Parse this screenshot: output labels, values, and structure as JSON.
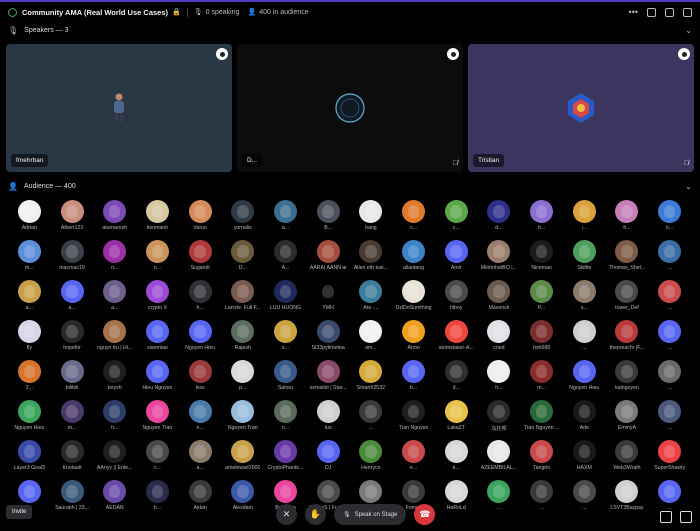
{
  "topbar": {
    "title": "Community AMA (Real World Use Cases)",
    "speaking": "0 speaking",
    "audience_count": "400 in audience"
  },
  "speakers_section": {
    "label": "Speakers — 3"
  },
  "speakers": [
    {
      "name": "fmehrban",
      "bg": "#2a3846",
      "figure": "person"
    },
    {
      "name": "D...",
      "bg": "#0c0c0d",
      "figure": "orb"
    },
    {
      "name": "Tristian",
      "bg": "#3b3560",
      "figure": "lion"
    }
  ],
  "audience_section": {
    "label": "Audience — 400"
  },
  "audience": [
    {
      "name": "Adrian",
      "color": "#f0f0f0"
    },
    {
      "name": "Albert123",
      "color": "#c98d7e"
    },
    {
      "name": "aturnaresh",
      "color": "#7b4bb3"
    },
    {
      "name": "tienmanh",
      "color": "#d6c7a1"
    },
    {
      "name": "Varun",
      "color": "#d68a5b"
    },
    {
      "name": "yurnalis",
      "color": "#2f3a45"
    },
    {
      "name": "a...",
      "color": "#3c6e8f"
    },
    {
      "name": "B...",
      "color": "#4a4f5a"
    },
    {
      "name": "bang",
      "color": "#e8e8e8"
    },
    {
      "name": "c...",
      "color": "#e07a2e"
    },
    {
      "name": "c...",
      "color": "#5ba84b"
    },
    {
      "name": "d...",
      "color": "#2d2f8a"
    },
    {
      "name": "h...",
      "color": "#8a6fd1"
    },
    {
      "name": "j...",
      "color": "#d9a23b"
    },
    {
      "name": "h...",
      "color": "#c77db8"
    },
    {
      "name": "k...",
      "color": "#3d7bd6"
    },
    {
      "name": "m...",
      "color": "#5b8fd9"
    },
    {
      "name": "macmac19",
      "color": "#3b3f48"
    },
    {
      "name": "n...",
      "color": "#9b2fa8"
    },
    {
      "name": "n...",
      "color": "#c9935a"
    },
    {
      "name": "Sugandi",
      "color": "#b03a3a"
    },
    {
      "name": "D...",
      "color": "#6b5a3a"
    },
    {
      "name": "A...",
      "color": "#2c2c2c"
    },
    {
      "name": "AARA| AANN ai",
      "color": "#a54f3e"
    },
    {
      "name": "Allen eth tusi...",
      "color": "#4a3b32"
    },
    {
      "name": "aliantang",
      "color": "#3c84c7"
    },
    {
      "name": "Amir",
      "color": "#5865f2"
    },
    {
      "name": "MinhnhatBO |...",
      "color": "#9a7e6c"
    },
    {
      "name": "Niceman",
      "color": "#1c1c1c"
    },
    {
      "name": "Skittle",
      "color": "#4f9e5b"
    },
    {
      "name": "Thomas_Shel...",
      "color": "#7d5b46"
    },
    {
      "name": "...",
      "color": "#3a6ea5"
    },
    {
      "name": "a...",
      "color": "#c9a04a"
    },
    {
      "name": "a...",
      "color": "#5865f2"
    },
    {
      "name": "a...",
      "color": "#6d5e8a"
    },
    {
      "name": "crypto X",
      "color": "#9b4bd6"
    },
    {
      "name": "h...",
      "color": "#2f3136"
    },
    {
      "name": "Larrzle: Full F...",
      "color": "#7a5c4f"
    },
    {
      "name": "LUU HUONG",
      "color": "#1f2a5c"
    },
    {
      "name": "YMH",
      "color": "#000000"
    },
    {
      "name": "Ata -...",
      "color": "#3d7d9c"
    },
    {
      "name": "DziDoSumthing",
      "color": "#e8e3d6"
    },
    {
      "name": "hiboy",
      "color": "#4b4b4b"
    },
    {
      "name": "Maverick",
      "color": "#6b5c4e"
    },
    {
      "name": "P...",
      "color": "#5a8a4a"
    },
    {
      "name": "s...",
      "color": "#8c7a6b"
    },
    {
      "name": "tower_Def",
      "color": "#4a4a4a"
    },
    {
      "name": "...",
      "color": "#c94d4d"
    },
    {
      "name": "fly",
      "color": "#d9d4e8"
    },
    {
      "name": "hopefor",
      "color": "#2a2a2a"
    },
    {
      "name": "nguyn tru | Hi...",
      "color": "#a5734b"
    },
    {
      "name": "xiaomiao",
      "color": "#5865f2"
    },
    {
      "name": "Nguyen Hieu",
      "color": "#5865f2"
    },
    {
      "name": "Rajesh",
      "color": "#5b6d5e"
    },
    {
      "name": "s...",
      "color": "#c9a440"
    },
    {
      "name": "SI33pytimetea",
      "color": "#3a4a6d"
    },
    {
      "name": "am...",
      "color": "#f1f1f1"
    },
    {
      "name": "Anon",
      "color": "#f0a020"
    },
    {
      "name": "atomstaker-A...",
      "color": "#f0473e"
    },
    {
      "name": "cried",
      "color": "#e0e0e6"
    },
    {
      "name": "hsh688",
      "color": "#7a2e2e"
    },
    {
      "name": "...",
      "color": "#cfcfcf"
    },
    {
      "name": "thepreachr |F...",
      "color": "#b83a3a"
    },
    {
      "name": "...",
      "color": "#5865f2"
    },
    {
      "name": "2...",
      "color": "#d8732c"
    },
    {
      "name": "bilibili",
      "color": "#6a6a8a"
    },
    {
      "name": "boysh",
      "color": "#1f1f1f"
    },
    {
      "name": "Hieu Nguyen",
      "color": "#5865f2"
    },
    {
      "name": "kiss",
      "color": "#9a3a3a"
    },
    {
      "name": "p...",
      "color": "#d9d9d9"
    },
    {
      "name": "Satoru",
      "color": "#3a5a8a"
    },
    {
      "name": "semalist | Star...",
      "color": "#8a4a6a"
    },
    {
      "name": "Smart#2532",
      "color": "#d4a83a"
    },
    {
      "name": "b...",
      "color": "#5865f2"
    },
    {
      "name": "d...",
      "color": "#2f2f2f"
    },
    {
      "name": "h...",
      "color": "#eeeeee"
    },
    {
      "name": "m...",
      "color": "#8a2c2c"
    },
    {
      "name": "Nguyen Hieu",
      "color": "#5865f2"
    },
    {
      "name": "kainguyen",
      "color": "#3a3a3a"
    },
    {
      "name": "...",
      "color": "#6a6a6a"
    },
    {
      "name": "Nguyen Hieu",
      "color": "#3ba55d"
    },
    {
      "name": "m...",
      "color": "#4a3a6a"
    },
    {
      "name": "h...",
      "color": "#2c3e66"
    },
    {
      "name": "Nguyen Tran",
      "color": "#eb459e"
    },
    {
      "name": "n...",
      "color": "#4a7aa8"
    },
    {
      "name": "Nguyen Tran",
      "color": "#9abcdd"
    },
    {
      "name": "n...",
      "color": "#5a6a5a"
    },
    {
      "name": "luo",
      "color": "#cfcfcf"
    },
    {
      "name": "...",
      "color": "#3a3a3a"
    },
    {
      "name": "Tran Nguyen",
      "color": "#1f1f1f"
    },
    {
      "name": "LakaZT",
      "color": "#e8c24a"
    },
    {
      "name": "乌托邦",
      "color": "#2a2a2a"
    },
    {
      "name": "Tran Nguyen ...",
      "color": "#2a6a3a"
    },
    {
      "name": "Ade",
      "color": "#1a1a1a"
    },
    {
      "name": "EmmyA",
      "color": "#7a7a7a"
    },
    {
      "name": "...",
      "color": "#4a5a7a"
    },
    {
      "name": "Layer3 Goal3",
      "color": "#3a4aa8"
    },
    {
      "name": "Knotaafi",
      "color": "#2a2a2a"
    },
    {
      "name": "AAnyy || Ente...",
      "color": "#1f1f1f"
    },
    {
      "name": "c...",
      "color": "#4a4a4a"
    },
    {
      "name": "a...",
      "color": "#8a7a6a"
    },
    {
      "name": "amelewa#2000",
      "color": "#c9a04a"
    },
    {
      "name": "CryptoPhanto...",
      "color": "#6a3aa8"
    },
    {
      "name": "DJ",
      "color": "#5865f2"
    },
    {
      "name": "Henrycn",
      "color": "#4a8a3a"
    },
    {
      "name": "e...",
      "color": "#c94a4a"
    },
    {
      "name": "k...",
      "color": "#d8d8d8"
    },
    {
      "name": "AZEEMBILAL...",
      "color": "#e8e8e8"
    },
    {
      "name": "Tangiro",
      "color": "#c94a4a"
    },
    {
      "name": "HAXM",
      "color": "#1a1a1a"
    },
    {
      "name": "Web3Wrath",
      "color": "#3a3a3a"
    },
    {
      "name": "SuperShawty",
      "color": "#ed4245"
    },
    {
      "name": "...",
      "color": "#5865f2"
    },
    {
      "name": "Saurabh | 23...",
      "color": "#3a5a7a"
    },
    {
      "name": "AEDAN",
      "color": "#6a4aa8"
    },
    {
      "name": "h...",
      "color": "#2a2a4a"
    },
    {
      "name": "Aidan",
      "color": "#3a3a3a"
    },
    {
      "name": "Alexdam",
      "color": "#3a5aa8"
    },
    {
      "name": "Babyuga",
      "color": "#eb459e"
    },
    {
      "name": "CryptoS | Fuso...",
      "color": "#4a4a4a"
    },
    {
      "name": "...",
      "color": "#7a7a7a"
    },
    {
      "name": "Fomos",
      "color": "#3a3a3a"
    },
    {
      "name": "HaRoLd",
      "color": "#d8d8d8"
    },
    {
      "name": "...",
      "color": "#3ba55d"
    },
    {
      "name": "...",
      "color": "#3a3a3a"
    },
    {
      "name": "...",
      "color": "#4a4a4a"
    },
    {
      "name": "LSVT3Bazpay",
      "color": "#cfcfcf"
    },
    {
      "name": "...",
      "color": "#5865f2"
    }
  ],
  "footer": {
    "invite_label": "Invite",
    "speak_label": "Speak on Stage"
  }
}
